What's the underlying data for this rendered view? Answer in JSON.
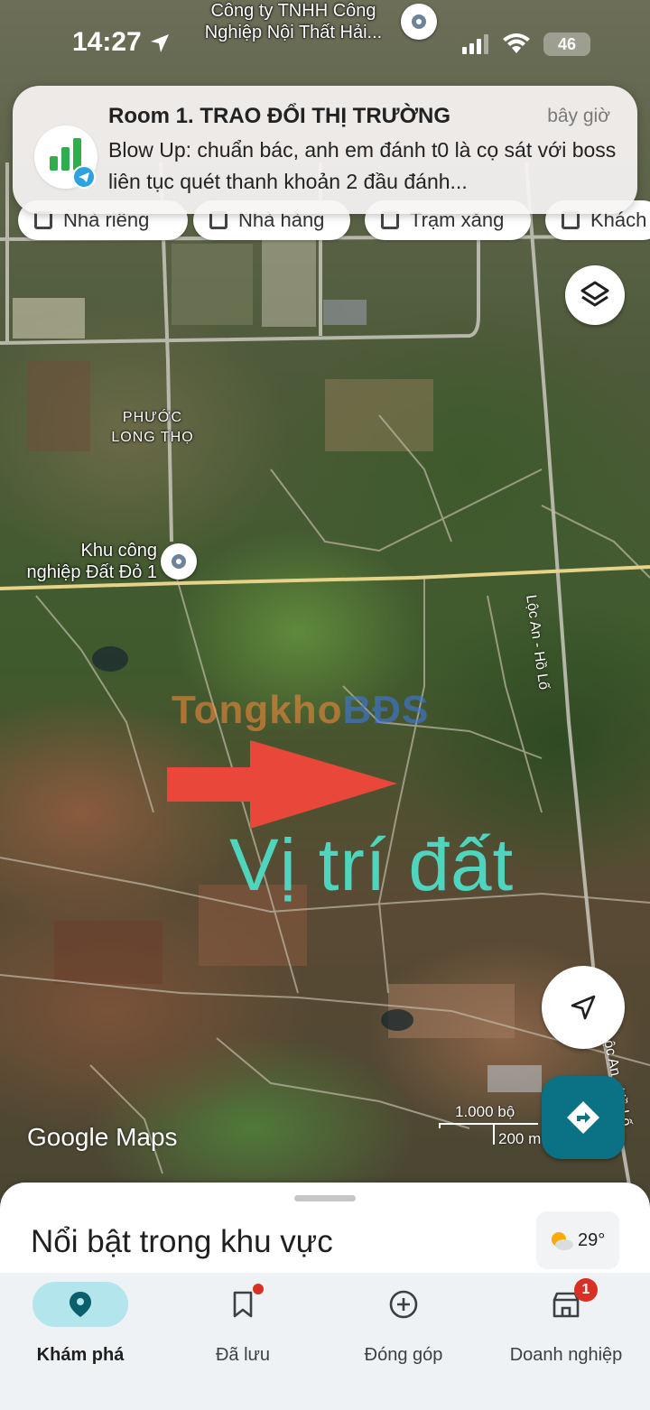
{
  "status_bar": {
    "time": "14:27",
    "battery": "46"
  },
  "notification": {
    "title": "Room 1. TRAO ĐỔI THỊ TRƯỜNG",
    "time": "bây giờ",
    "body": "Blow Up: chuẩn bác, anh em đánh t0 là cọ sát với boss liên tục quét thanh khoản 2 đầu đánh...",
    "app_icon": "telegram-group-icon"
  },
  "chips": [
    {
      "label": "Nhà riêng",
      "icon": "home-icon"
    },
    {
      "label": "Nhà hàng",
      "icon": "restaurant-icon"
    },
    {
      "label": "Trạm xăng",
      "icon": "gas-station-icon"
    },
    {
      "label": "Khách",
      "icon": "hotel-icon"
    }
  ],
  "map": {
    "labels": {
      "company_top": "Công ty TNHH Công\nNghiệp Nội Thất Hải...",
      "area": "PHƯỚC\nLONG THỌ",
      "industrial_zone": "Khu công\nnghiệp Đất Đỏ 1",
      "road_right_1": "Lộc An - Hồ Lố",
      "road_right_2": "Lộc An - Hồ Lố"
    },
    "watermark_part1": "Tongkho",
    "watermark_part2": "BĐS",
    "overlay_text": "Vị trí đất",
    "attribution": "Google Maps",
    "scale": {
      "imperial": "1.000 bộ",
      "metric": "200 m"
    }
  },
  "sheet": {
    "title": "Nổi bật trong khu vực",
    "weather": "29°"
  },
  "nav": {
    "items": [
      {
        "label": "Khám phá",
        "icon": "location-pin-icon",
        "active": true
      },
      {
        "label": "Đã lưu",
        "icon": "bookmark-icon"
      },
      {
        "label": "Đóng góp",
        "icon": "add-circle-icon"
      },
      {
        "label": "Doanh nghiệp",
        "icon": "storefront-icon",
        "badge": "1"
      }
    ]
  }
}
